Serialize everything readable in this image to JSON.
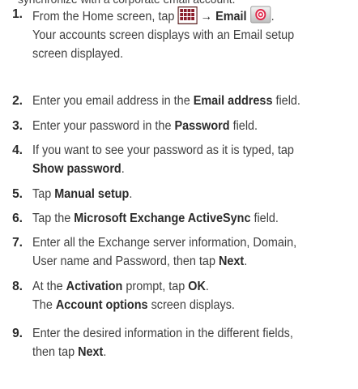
{
  "intro": "synchronize with a corporate email account.",
  "icons": {
    "apps": "apps-grid-icon",
    "email": "email-app-icon",
    "accent": "#e0284a"
  },
  "steps": [
    {
      "number": "1.",
      "parts": [
        "From the Home screen, tap ",
        "",
        " → ",
        "Email",
        " "
      ],
      "note": [
        "Your accounts screen displays with an Email setup",
        "screen displayed."
      ]
    },
    {
      "number": "2.",
      "text_before": "Enter you email address in the ",
      "bold": "Email address",
      "text_after": " field."
    },
    {
      "number": "3.",
      "text_before": "Enter your password in the ",
      "bold": "Password",
      "text_after": " field."
    },
    {
      "number": "4.",
      "line1": "If you want to see your password as it is typed, tap",
      "bold": "Show password",
      "text_after": "."
    },
    {
      "number": "5.",
      "text_before": "Tap ",
      "bold": "Manual setup",
      "text_after": "."
    },
    {
      "number": "6.",
      "text_before": "Tap the ",
      "bold": "Microsoft Exchange ActiveSync",
      "text_after": " field."
    },
    {
      "number": "7.",
      "line1": "Enter all the Exchange server information, Domain,",
      "text_before": "User name and Password, then tap ",
      "bold": "Next",
      "text_after": "."
    },
    {
      "number": "8.",
      "text_before": "At the ",
      "bold": "Activation",
      "text_mid": " prompt, tap ",
      "bold2": "OK",
      "text_after": ".",
      "note_before": "The ",
      "note_bold": "Account options",
      "note_after": " screen displays."
    },
    {
      "number": "9.",
      "line1": "Enter the desired information in the different fields,",
      "text_before": "then tap ",
      "bold": "Next",
      "text_after": "."
    }
  ]
}
